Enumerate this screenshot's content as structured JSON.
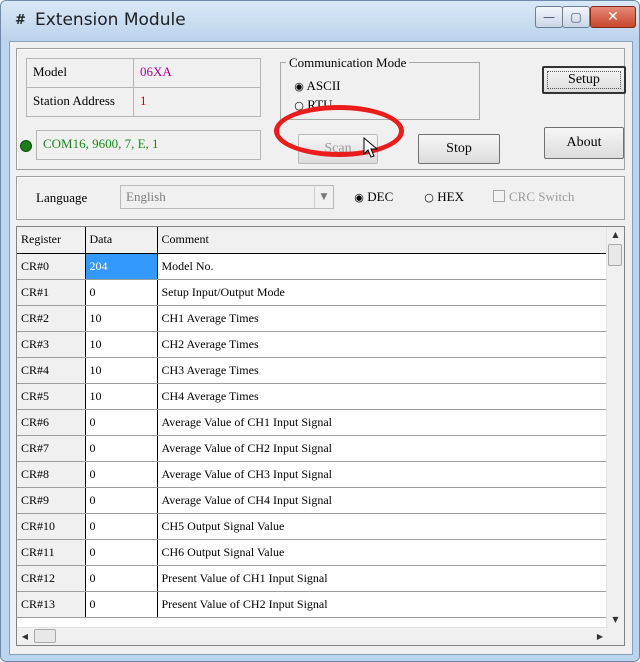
{
  "window": {
    "title": "Extension Module",
    "icon": "hash-network-icon",
    "controls": {
      "minimize": "—",
      "maximize": "▢",
      "close": "✕"
    }
  },
  "info": {
    "model_label": "Model",
    "model_value": "06XA",
    "station_label": "Station Address",
    "station_value": "1",
    "connection": "COM16, 9600, 7, E, 1",
    "led_color": "#1b7d1b"
  },
  "comm_mode": {
    "title": "Communication Mode",
    "options": [
      {
        "label": "ASCII",
        "selected": true
      },
      {
        "label": "RTU",
        "selected": false
      }
    ]
  },
  "buttons": {
    "setup": "Setup",
    "scan": "Scan",
    "stop": "Stop",
    "about": "About"
  },
  "language": {
    "label": "Language",
    "value": "English",
    "dec": "DEC",
    "hex": "HEX",
    "crc": "CRC Switch"
  },
  "table": {
    "headers": [
      "Register",
      "Data",
      "Comment"
    ],
    "rows": [
      [
        "CR#0",
        "204",
        "Model No."
      ],
      [
        "CR#1",
        "0",
        "Setup Input/Output Mode"
      ],
      [
        "CR#2",
        "10",
        "CH1 Average Times"
      ],
      [
        "CR#3",
        "10",
        "CH2 Average Times"
      ],
      [
        "CR#4",
        "10",
        "CH3 Average Times"
      ],
      [
        "CR#5",
        "10",
        "CH4 Average Times"
      ],
      [
        "CR#6",
        "0",
        "Average Value of CH1 Input Signal"
      ],
      [
        "CR#7",
        "0",
        "Average Value of CH2 Input Signal"
      ],
      [
        "CR#8",
        "0",
        "Average Value of CH3 Input Signal"
      ],
      [
        "CR#9",
        "0",
        "Average Value of CH4 Input Signal"
      ],
      [
        "CR#10",
        "0",
        "CH5 Output Signal Value"
      ],
      [
        "CR#11",
        "0",
        "CH6 Output Signal Value"
      ],
      [
        "CR#12",
        "0",
        "Present Value of CH1 Input Signal"
      ],
      [
        "CR#13",
        "0",
        "Present Value of CH2 Input Signal"
      ]
    ]
  },
  "colors": {
    "highlight": "#ea1c1c",
    "selection": "#3399ff"
  }
}
